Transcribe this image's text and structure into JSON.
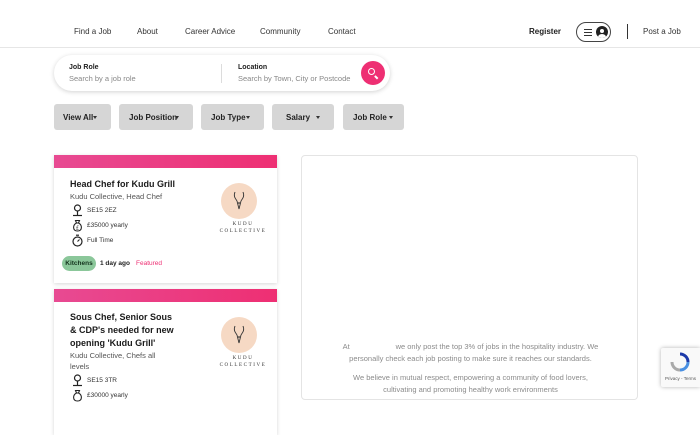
{
  "nav": {
    "links": [
      "Find a Job",
      "About",
      "Career Advice",
      "Community",
      "Contact"
    ],
    "register": "Register",
    "post_job": "Post a Job"
  },
  "search": {
    "role_label": "Job Role",
    "role_placeholder": "Search by a job role",
    "location_label": "Location",
    "location_placeholder": "Search by Town, City or Postcode",
    "button_icon": "search-icon"
  },
  "filters": [
    "View All",
    "Job Position",
    "Job Type",
    "Salary",
    "Job Role"
  ],
  "jobs": [
    {
      "title_lines": [
        "Head Chef for Kudu Grill"
      ],
      "company_lines": [
        "Kudu Collective, Head Chef"
      ],
      "postcode": "SE15 2EZ",
      "salary": "£35000 yearly",
      "type": "Full Time",
      "tag": "Kitchens",
      "posted": "1 day ago",
      "featured": "Featured",
      "logo_lines": [
        "KUDU",
        "COLLECTIVE"
      ]
    },
    {
      "title_lines": [
        "Sous Chef, Senior Sous",
        "& CDP's needed for new",
        "opening 'Kudu Grill'"
      ],
      "company_lines": [
        "Kudu Collective, Chefs all",
        "levels"
      ],
      "postcode": "SE15 3TR",
      "salary": "£30000 yearly",
      "logo_lines": [
        "KUDU",
        "COLLECTIVE"
      ]
    }
  ],
  "info": {
    "line1": "At                      we only post the top 3% of jobs in the hospitality industry. We",
    "line2": "personally check each job posting to make sure it reaches our standards.",
    "line3": "We believe in mutual respect, empowering a community of food lovers,",
    "line4": "cultivating and promoting healthy work environments"
  },
  "recaptcha": {
    "links": "Privacy - Terms"
  },
  "colors": {
    "accent": "#ee2f73",
    "tag": "#8bc79a",
    "filter_bg": "#d6d6d6"
  }
}
